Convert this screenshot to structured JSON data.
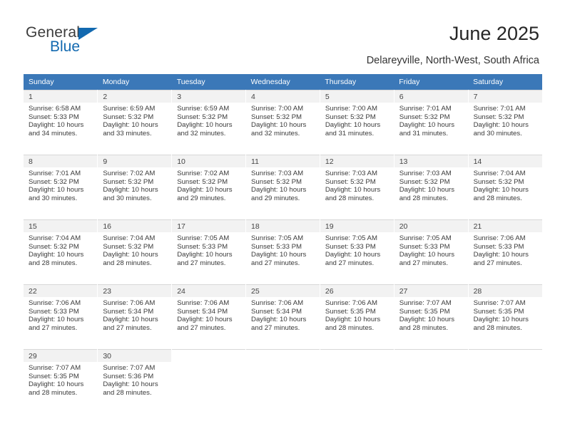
{
  "brand": {
    "name_part1": "General",
    "name_part2": "Blue",
    "triangle_color": "#1269b0",
    "text_color": "#3c3c3c"
  },
  "header": {
    "title": "June 2025",
    "subtitle": "Delareyville, North-West, South Africa"
  },
  "theme": {
    "header_row_bg": "#3b78b8",
    "header_row_text": "#ffffff",
    "daynum_band_bg": "#f2f2f2",
    "grid_line": "#d8d8d8",
    "body_text": "#3a3a3a"
  },
  "weekday_headers": [
    "Sunday",
    "Monday",
    "Tuesday",
    "Wednesday",
    "Thursday",
    "Friday",
    "Saturday"
  ],
  "labels": {
    "sunrise_prefix": "Sunrise:",
    "sunset_prefix": "Sunset:",
    "daylight_prefix": "Daylight:"
  },
  "weeks": [
    [
      {
        "day": "1",
        "sunrise": "Sunrise: 6:58 AM",
        "sunset": "Sunset: 5:33 PM",
        "daylight_l1": "Daylight: 10 hours",
        "daylight_l2": "and 34 minutes."
      },
      {
        "day": "2",
        "sunrise": "Sunrise: 6:59 AM",
        "sunset": "Sunset: 5:32 PM",
        "daylight_l1": "Daylight: 10 hours",
        "daylight_l2": "and 33 minutes."
      },
      {
        "day": "3",
        "sunrise": "Sunrise: 6:59 AM",
        "sunset": "Sunset: 5:32 PM",
        "daylight_l1": "Daylight: 10 hours",
        "daylight_l2": "and 32 minutes."
      },
      {
        "day": "4",
        "sunrise": "Sunrise: 7:00 AM",
        "sunset": "Sunset: 5:32 PM",
        "daylight_l1": "Daylight: 10 hours",
        "daylight_l2": "and 32 minutes."
      },
      {
        "day": "5",
        "sunrise": "Sunrise: 7:00 AM",
        "sunset": "Sunset: 5:32 PM",
        "daylight_l1": "Daylight: 10 hours",
        "daylight_l2": "and 31 minutes."
      },
      {
        "day": "6",
        "sunrise": "Sunrise: 7:01 AM",
        "sunset": "Sunset: 5:32 PM",
        "daylight_l1": "Daylight: 10 hours",
        "daylight_l2": "and 31 minutes."
      },
      {
        "day": "7",
        "sunrise": "Sunrise: 7:01 AM",
        "sunset": "Sunset: 5:32 PM",
        "daylight_l1": "Daylight: 10 hours",
        "daylight_l2": "and 30 minutes."
      }
    ],
    [
      {
        "day": "8",
        "sunrise": "Sunrise: 7:01 AM",
        "sunset": "Sunset: 5:32 PM",
        "daylight_l1": "Daylight: 10 hours",
        "daylight_l2": "and 30 minutes."
      },
      {
        "day": "9",
        "sunrise": "Sunrise: 7:02 AM",
        "sunset": "Sunset: 5:32 PM",
        "daylight_l1": "Daylight: 10 hours",
        "daylight_l2": "and 30 minutes."
      },
      {
        "day": "10",
        "sunrise": "Sunrise: 7:02 AM",
        "sunset": "Sunset: 5:32 PM",
        "daylight_l1": "Daylight: 10 hours",
        "daylight_l2": "and 29 minutes."
      },
      {
        "day": "11",
        "sunrise": "Sunrise: 7:03 AM",
        "sunset": "Sunset: 5:32 PM",
        "daylight_l1": "Daylight: 10 hours",
        "daylight_l2": "and 29 minutes."
      },
      {
        "day": "12",
        "sunrise": "Sunrise: 7:03 AM",
        "sunset": "Sunset: 5:32 PM",
        "daylight_l1": "Daylight: 10 hours",
        "daylight_l2": "and 28 minutes."
      },
      {
        "day": "13",
        "sunrise": "Sunrise: 7:03 AM",
        "sunset": "Sunset: 5:32 PM",
        "daylight_l1": "Daylight: 10 hours",
        "daylight_l2": "and 28 minutes."
      },
      {
        "day": "14",
        "sunrise": "Sunrise: 7:04 AM",
        "sunset": "Sunset: 5:32 PM",
        "daylight_l1": "Daylight: 10 hours",
        "daylight_l2": "and 28 minutes."
      }
    ],
    [
      {
        "day": "15",
        "sunrise": "Sunrise: 7:04 AM",
        "sunset": "Sunset: 5:32 PM",
        "daylight_l1": "Daylight: 10 hours",
        "daylight_l2": "and 28 minutes."
      },
      {
        "day": "16",
        "sunrise": "Sunrise: 7:04 AM",
        "sunset": "Sunset: 5:32 PM",
        "daylight_l1": "Daylight: 10 hours",
        "daylight_l2": "and 28 minutes."
      },
      {
        "day": "17",
        "sunrise": "Sunrise: 7:05 AM",
        "sunset": "Sunset: 5:33 PM",
        "daylight_l1": "Daylight: 10 hours",
        "daylight_l2": "and 27 minutes."
      },
      {
        "day": "18",
        "sunrise": "Sunrise: 7:05 AM",
        "sunset": "Sunset: 5:33 PM",
        "daylight_l1": "Daylight: 10 hours",
        "daylight_l2": "and 27 minutes."
      },
      {
        "day": "19",
        "sunrise": "Sunrise: 7:05 AM",
        "sunset": "Sunset: 5:33 PM",
        "daylight_l1": "Daylight: 10 hours",
        "daylight_l2": "and 27 minutes."
      },
      {
        "day": "20",
        "sunrise": "Sunrise: 7:05 AM",
        "sunset": "Sunset: 5:33 PM",
        "daylight_l1": "Daylight: 10 hours",
        "daylight_l2": "and 27 minutes."
      },
      {
        "day": "21",
        "sunrise": "Sunrise: 7:06 AM",
        "sunset": "Sunset: 5:33 PM",
        "daylight_l1": "Daylight: 10 hours",
        "daylight_l2": "and 27 minutes."
      }
    ],
    [
      {
        "day": "22",
        "sunrise": "Sunrise: 7:06 AM",
        "sunset": "Sunset: 5:33 PM",
        "daylight_l1": "Daylight: 10 hours",
        "daylight_l2": "and 27 minutes."
      },
      {
        "day": "23",
        "sunrise": "Sunrise: 7:06 AM",
        "sunset": "Sunset: 5:34 PM",
        "daylight_l1": "Daylight: 10 hours",
        "daylight_l2": "and 27 minutes."
      },
      {
        "day": "24",
        "sunrise": "Sunrise: 7:06 AM",
        "sunset": "Sunset: 5:34 PM",
        "daylight_l1": "Daylight: 10 hours",
        "daylight_l2": "and 27 minutes."
      },
      {
        "day": "25",
        "sunrise": "Sunrise: 7:06 AM",
        "sunset": "Sunset: 5:34 PM",
        "daylight_l1": "Daylight: 10 hours",
        "daylight_l2": "and 27 minutes."
      },
      {
        "day": "26",
        "sunrise": "Sunrise: 7:06 AM",
        "sunset": "Sunset: 5:35 PM",
        "daylight_l1": "Daylight: 10 hours",
        "daylight_l2": "and 28 minutes."
      },
      {
        "day": "27",
        "sunrise": "Sunrise: 7:07 AM",
        "sunset": "Sunset: 5:35 PM",
        "daylight_l1": "Daylight: 10 hours",
        "daylight_l2": "and 28 minutes."
      },
      {
        "day": "28",
        "sunrise": "Sunrise: 7:07 AM",
        "sunset": "Sunset: 5:35 PM",
        "daylight_l1": "Daylight: 10 hours",
        "daylight_l2": "and 28 minutes."
      }
    ],
    [
      {
        "day": "29",
        "sunrise": "Sunrise: 7:07 AM",
        "sunset": "Sunset: 5:35 PM",
        "daylight_l1": "Daylight: 10 hours",
        "daylight_l2": "and 28 minutes."
      },
      {
        "day": "30",
        "sunrise": "Sunrise: 7:07 AM",
        "sunset": "Sunset: 5:36 PM",
        "daylight_l1": "Daylight: 10 hours",
        "daylight_l2": "and 28 minutes."
      },
      {
        "day": "",
        "sunrise": "",
        "sunset": "",
        "daylight_l1": "",
        "daylight_l2": ""
      },
      {
        "day": "",
        "sunrise": "",
        "sunset": "",
        "daylight_l1": "",
        "daylight_l2": ""
      },
      {
        "day": "",
        "sunrise": "",
        "sunset": "",
        "daylight_l1": "",
        "daylight_l2": ""
      },
      {
        "day": "",
        "sunrise": "",
        "sunset": "",
        "daylight_l1": "",
        "daylight_l2": ""
      },
      {
        "day": "",
        "sunrise": "",
        "sunset": "",
        "daylight_l1": "",
        "daylight_l2": ""
      }
    ]
  ]
}
